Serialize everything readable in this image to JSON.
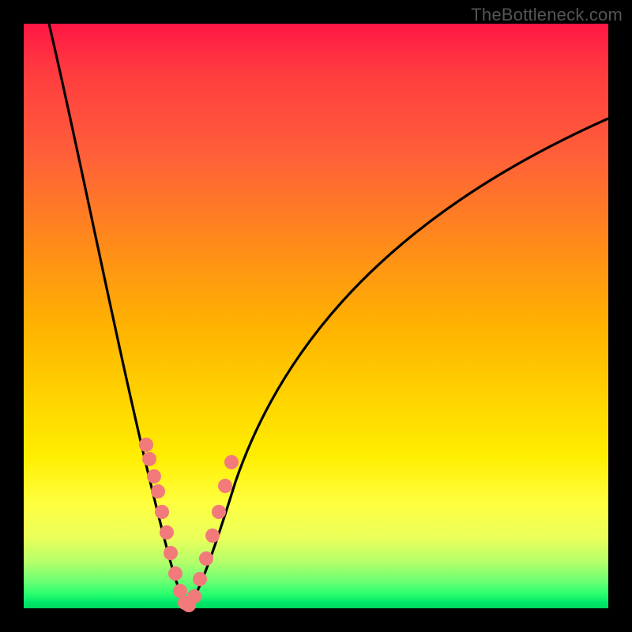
{
  "watermark": {
    "text": "TheBottleneck.com"
  },
  "colors": {
    "background_black": "#000000",
    "curve_stroke": "#000000",
    "dot_fill": "#f27a7a",
    "gradient_top": "#ff1744",
    "gradient_mid1": "#ff8c1a",
    "gradient_mid2": "#ffee00",
    "gradient_bottom": "#00d85e"
  },
  "chart_data": {
    "type": "line",
    "title": "",
    "xlabel": "",
    "ylabel": "",
    "xlim": [
      0,
      100
    ],
    "ylim": [
      0,
      100
    ],
    "notes": "V-shaped bottleneck curve. y is a mismatch/bottleneck magnitude (0 = ideal, 100 = worst). x is a relative component capability axis. The valley bottom sits around x≈26–30. Background color encodes y: red at top (high mismatch), green at bottom (low mismatch). Pink dots mark sampled points near the valley.",
    "series": [
      {
        "name": "bottleneck-curve-left",
        "x": [
          4,
          6,
          8,
          10,
          12,
          14,
          16,
          18,
          20,
          22,
          24,
          26,
          27,
          28
        ],
        "y": [
          100,
          92,
          84,
          76,
          68,
          60,
          52,
          43,
          34,
          25,
          16,
          7,
          3,
          0
        ]
      },
      {
        "name": "bottleneck-curve-right",
        "x": [
          28,
          30,
          32,
          35,
          38,
          42,
          47,
          53,
          60,
          68,
          77,
          87,
          98
        ],
        "y": [
          0,
          4,
          10,
          18,
          26,
          34,
          42,
          50,
          58,
          65,
          72,
          78,
          83
        ]
      }
    ],
    "sample_dots": {
      "name": "measured-samples",
      "x": [
        21.0,
        21.5,
        22.3,
        22.9,
        23.6,
        24.4,
        25.2,
        26.0,
        26.8,
        27.5,
        28.3,
        29.2,
        30.2,
        31.2,
        32.3,
        33.4,
        34.5,
        35.6
      ],
      "y": [
        28.0,
        25.5,
        22.5,
        20.0,
        16.5,
        13.0,
        9.5,
        6.0,
        3.0,
        1.0,
        0.5,
        2.0,
        5.0,
        8.5,
        12.5,
        16.5,
        21.0,
        25.0
      ]
    }
  }
}
